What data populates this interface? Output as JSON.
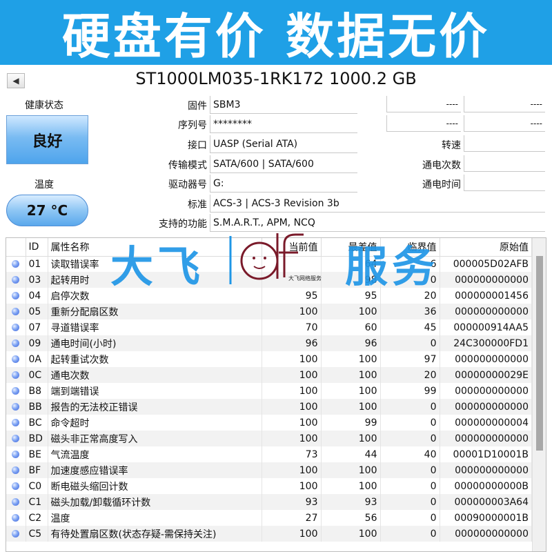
{
  "banner": {
    "text": "硬盘有价 数据无价"
  },
  "window": {
    "title": "ST1000LM035-1RK172 1000.2 GB"
  },
  "health": {
    "label": "健康状态",
    "value": "良好"
  },
  "temperature": {
    "label": "温度",
    "value": "27 °C"
  },
  "info": {
    "firmware": {
      "label": "固件",
      "value": "SBM3"
    },
    "serial": {
      "label": "序列号",
      "value": "********"
    },
    "interface": {
      "label": "接口",
      "value": "UASP (Serial ATA)"
    },
    "transfer": {
      "label": "传输模式",
      "value": "SATA/600 | SATA/600"
    },
    "drive_letter": {
      "label": "驱动器号",
      "value": "G:"
    },
    "standard": {
      "label": "标准",
      "value": "ACS-3 | ACS-3 Revision 3b"
    },
    "features": {
      "label": "支持的功能",
      "value": "S.M.A.R.T., APM, NCQ"
    }
  },
  "right_info": {
    "row1_left": "----",
    "row1_right": "----",
    "row2_left": "----",
    "row2_right": "----",
    "rotation_label": "转速",
    "power_count_label": "通电次数",
    "power_time_label": "通电时间"
  },
  "table": {
    "headers": {
      "id": "ID",
      "name": "属性名称",
      "current": "当前值",
      "worst": "最差值",
      "threshold": "临界值",
      "raw": "原始值"
    },
    "rows": [
      {
        "id": "01",
        "name": "读取错误率",
        "current": "",
        "worst": "64",
        "threshold": "6",
        "raw": "000005D02AFB"
      },
      {
        "id": "03",
        "name": "起转用时",
        "current": "",
        "worst": "98",
        "threshold": "0",
        "raw": "000000000000"
      },
      {
        "id": "04",
        "name": "启停次数",
        "current": "95",
        "worst": "95",
        "threshold": "20",
        "raw": "000000001456"
      },
      {
        "id": "05",
        "name": "重新分配扇区数",
        "current": "100",
        "worst": "100",
        "threshold": "36",
        "raw": "000000000000"
      },
      {
        "id": "07",
        "name": "寻道错误率",
        "current": "70",
        "worst": "60",
        "threshold": "45",
        "raw": "000000914AA5"
      },
      {
        "id": "09",
        "name": "通电时间(小时)",
        "current": "96",
        "worst": "96",
        "threshold": "0",
        "raw": "24C300000FD1"
      },
      {
        "id": "0A",
        "name": "起转重试次数",
        "current": "100",
        "worst": "100",
        "threshold": "97",
        "raw": "000000000000"
      },
      {
        "id": "0C",
        "name": "通电次数",
        "current": "100",
        "worst": "100",
        "threshold": "20",
        "raw": "00000000029E"
      },
      {
        "id": "B8",
        "name": "端到端错误",
        "current": "100",
        "worst": "100",
        "threshold": "99",
        "raw": "000000000000"
      },
      {
        "id": "BB",
        "name": "报告的无法校正错误",
        "current": "100",
        "worst": "100",
        "threshold": "0",
        "raw": "000000000000"
      },
      {
        "id": "BC",
        "name": "命令超时",
        "current": "100",
        "worst": "99",
        "threshold": "0",
        "raw": "000000000004"
      },
      {
        "id": "BD",
        "name": "磁头非正常高度写入",
        "current": "100",
        "worst": "100",
        "threshold": "0",
        "raw": "000000000000"
      },
      {
        "id": "BE",
        "name": "气流温度",
        "current": "73",
        "worst": "44",
        "threshold": "40",
        "raw": "00001D10001B"
      },
      {
        "id": "BF",
        "name": "加速度感应错误率",
        "current": "100",
        "worst": "100",
        "threshold": "0",
        "raw": "000000000000"
      },
      {
        "id": "C0",
        "name": "断电磁头缩回计数",
        "current": "100",
        "worst": "100",
        "threshold": "0",
        "raw": "00000000000B"
      },
      {
        "id": "C1",
        "name": "磁头加载/卸载循环计数",
        "current": "93",
        "worst": "93",
        "threshold": "0",
        "raw": "000000003A64"
      },
      {
        "id": "C2",
        "name": "温度",
        "current": "27",
        "worst": "56",
        "threshold": "0",
        "raw": "00090000001B"
      },
      {
        "id": "C5",
        "name": "有待处置扇区数(状态存疑-需保持关注)",
        "current": "100",
        "worst": "100",
        "threshold": "0",
        "raw": "000000000000"
      }
    ]
  },
  "watermark": {
    "left": "大飞",
    "right": "服务",
    "logo_text": "大飞网络服务"
  },
  "colors": {
    "banner": "#1fa0e6",
    "health": "#4ea4ec",
    "status_dot": "#3c63d8"
  }
}
